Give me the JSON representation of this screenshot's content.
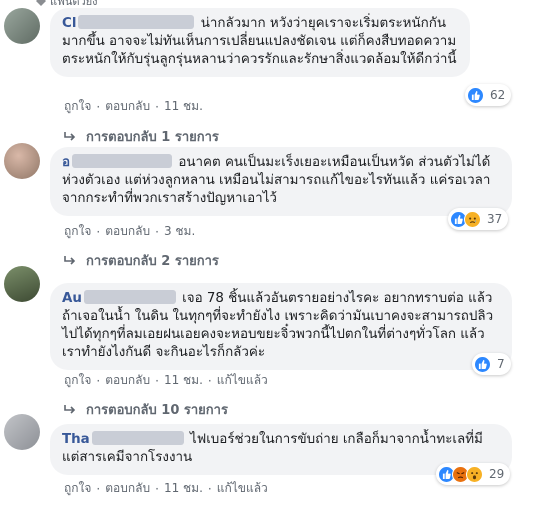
{
  "fan_badge": {
    "label": "แฟนตัวยง"
  },
  "comments": [
    {
      "author": "Cl",
      "text": "น่ากลัวมาก หวังว่ายุคเราจะเริ่มตระหนักกันมากขึ้น อาจจะไม่ทันเห็นการเปลี่ยนแปลงชัดเจน แต่ก็คงสืบทอดความตระหนักให้กับรุ่นลูกรุ่นหลานว่าควรรักและรักษาสิ่งแวดล้อมให้ดีกว่านี้",
      "reaction_count": "62",
      "actions": {
        "like": "ถูกใจ",
        "reply": "ตอบกลับ",
        "time": "11 ชม."
      },
      "replies_label": "การตอบกลับ 1 รายการ"
    },
    {
      "author": "อ",
      "text": "อนาคต คนเป็นมะเร็งเยอะเหมือนเป็นหวัด ส่วนตัวไม่ได้ห่วงตัวเอง แต่ห่วงลูกหลาน เหมือนไม่สามารถแก้ไขอะไรทันแล้ว แค่รอเวลาจากกระทำที่พวกเราสร้างปัญหาเอาไว้",
      "reaction_count": "37",
      "actions": {
        "like": "ถูกใจ",
        "reply": "ตอบกลับ",
        "time": "3 ชม."
      },
      "replies_label": "การตอบกลับ 2 รายการ"
    },
    {
      "author": "Au",
      "text": "เจอ 78 ชิ้นแล้วอันตรายอย่างไรคะ อยากทราบต่อ แล้วถ้าเจอในน้ำ ในดิน ในทุกๆที่จะทำยังไง เพราะคิดว่ามันเบาคงจะสามารถปลิวไปได้ทุกๆที่ลมเอยฝนเอยคงจะหอบขยะจิ๋วพวกนี้ไปตกในที่ต่างๆทั่วโลก แล้วเราทำยังไงกันดี จะกินอะไรก็กลัวค่ะ",
      "reaction_count": "7",
      "actions": {
        "like": "ถูกใจ",
        "reply": "ตอบกลับ",
        "time": "11 ชม.",
        "edited": "แก้ไขแล้ว"
      },
      "replies_label": "การตอบกลับ 10 รายการ"
    },
    {
      "author": "Tha",
      "text": "ไฟเบอร์ช่วยในการขับถ่าย เกลือก็มาจากน้ำทะเลที่มีแต่สารเคมีจากโรงงาน",
      "reaction_count": "29",
      "actions": {
        "like": "ถูกใจ",
        "reply": "ตอบกลับ",
        "time": "11 ชม.",
        "edited": "แก้ไขแล้ว"
      }
    }
  ],
  "colors": {
    "bubble": "#f2f3f5",
    "name": "#385898",
    "meta": "#606770",
    "like": "#2d88ff"
  }
}
